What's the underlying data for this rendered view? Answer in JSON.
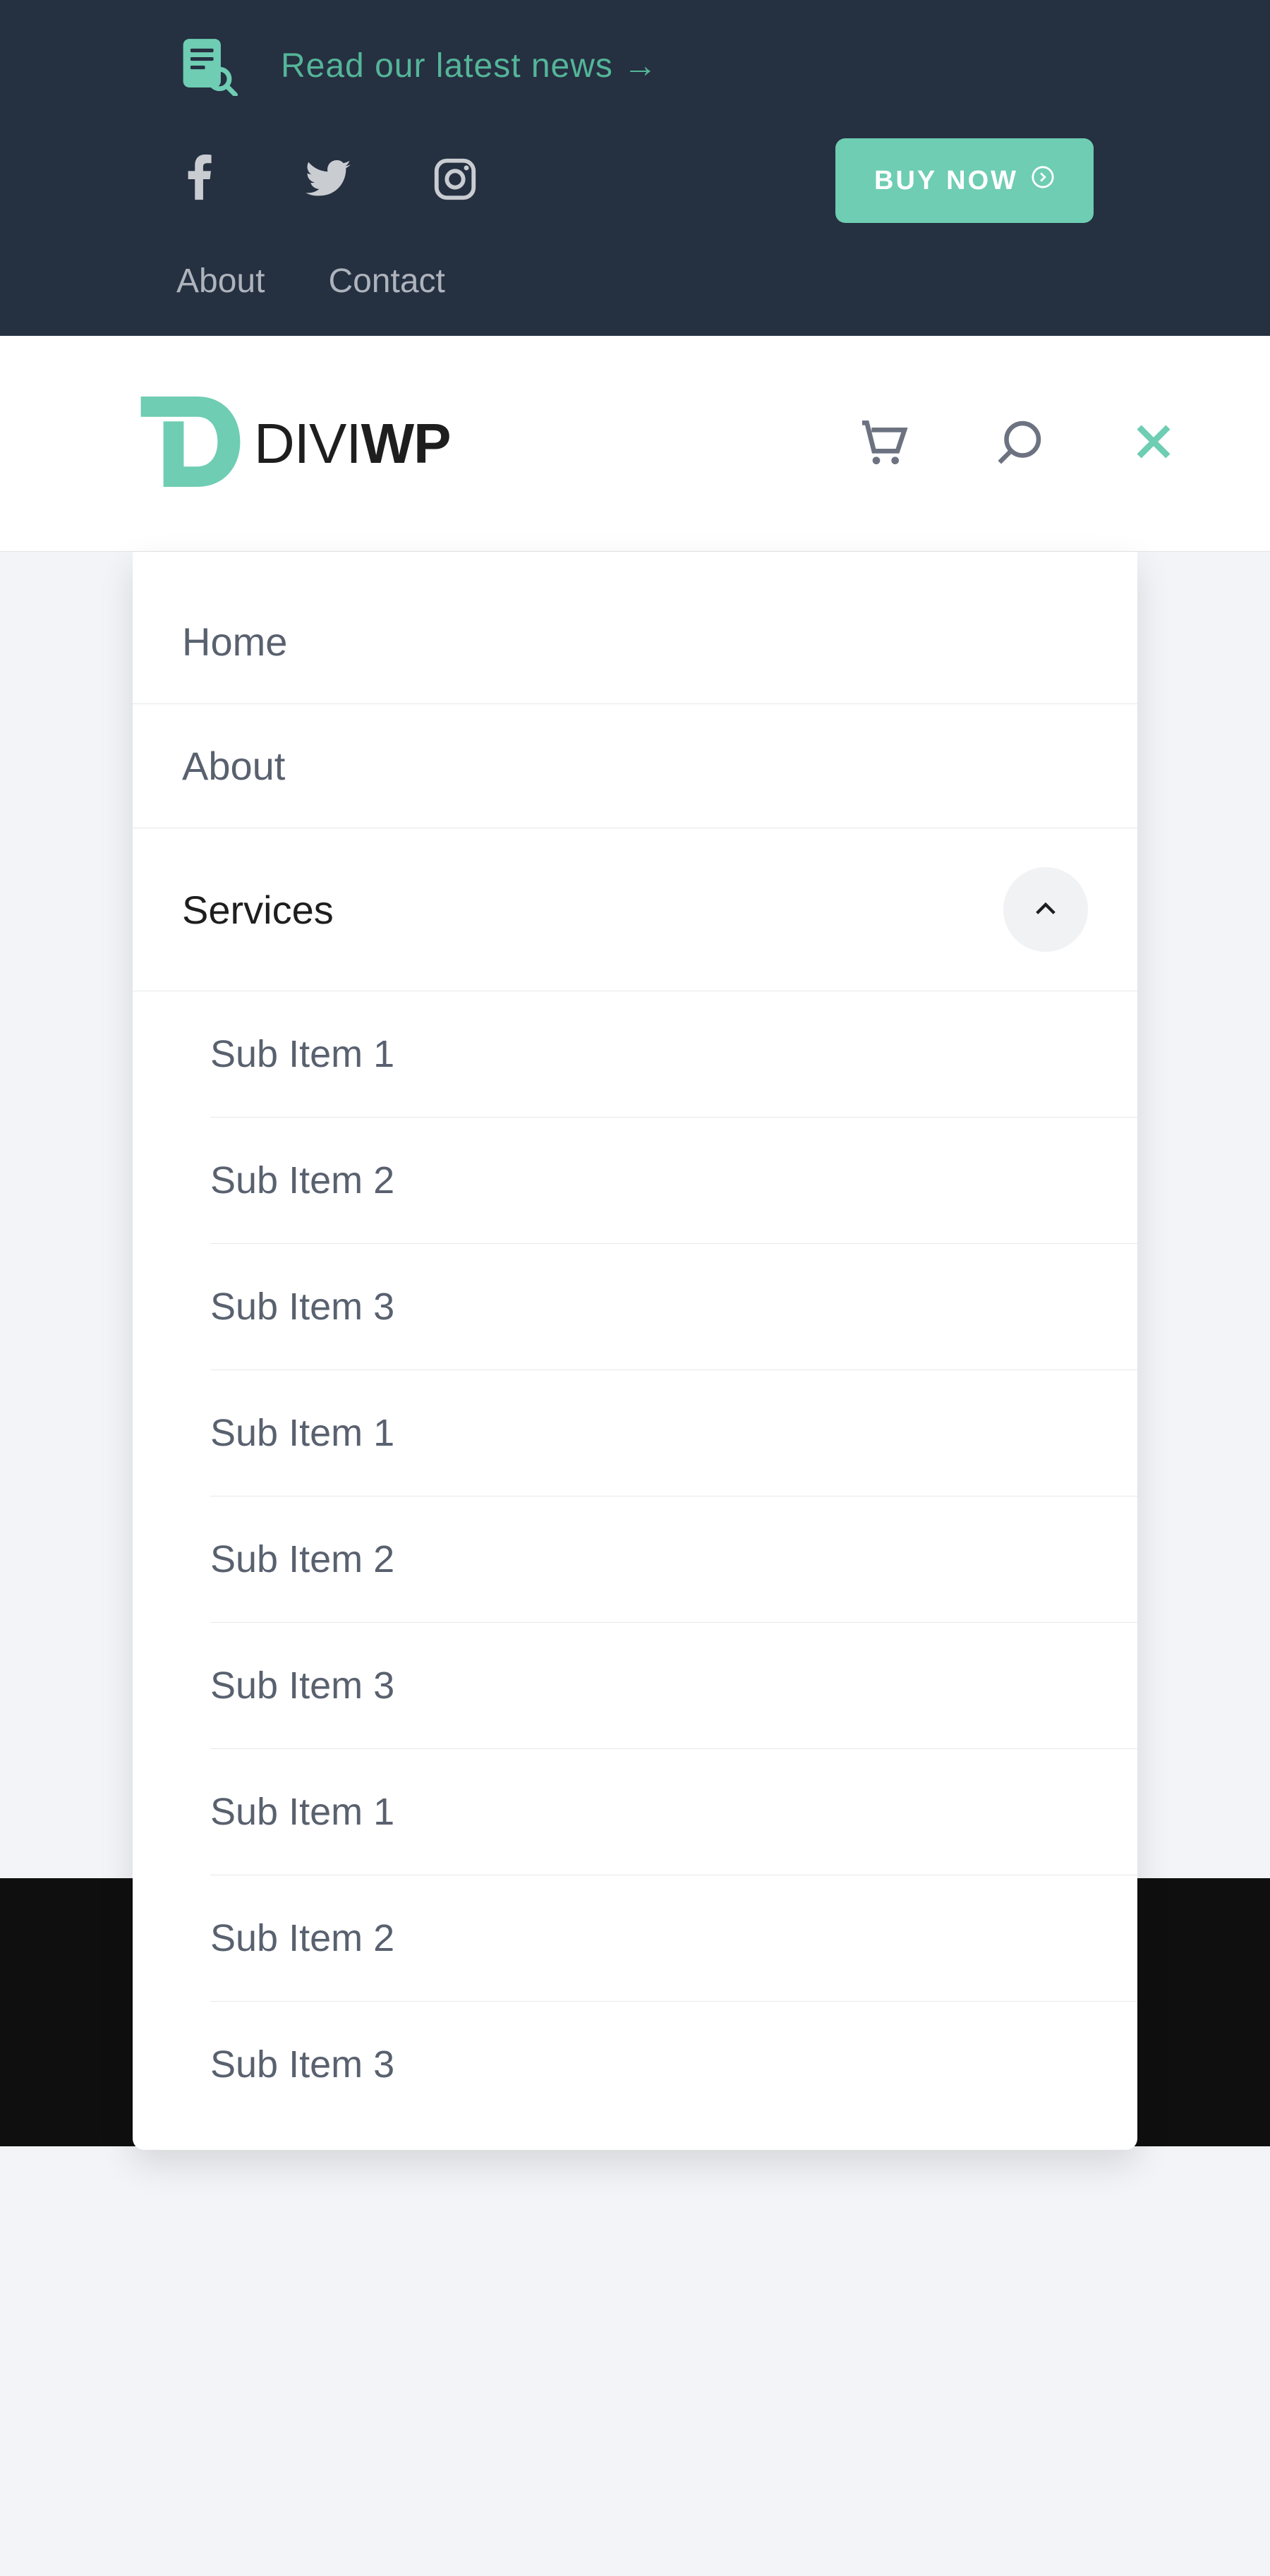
{
  "topbar": {
    "news_label": "Read our latest news →",
    "buy_label": "BUY NOW",
    "links": [
      "About",
      "Contact"
    ]
  },
  "header": {
    "logo_light": "DIVI",
    "logo_bold": "WP"
  },
  "menu": {
    "items": [
      {
        "label": "Home",
        "active": false
      },
      {
        "label": "About",
        "active": false
      },
      {
        "label": "Services",
        "active": true,
        "expanded": true
      }
    ],
    "sub_items": [
      "Sub Item 1",
      "Sub Item 2",
      "Sub Item 3",
      "Sub Item 1",
      "Sub Item 2",
      "Sub Item 3",
      "Sub Item 1",
      "Sub Item 2",
      "Sub Item 3"
    ]
  },
  "icons": {
    "news": "document-search-icon",
    "facebook": "facebook-icon",
    "twitter": "twitter-icon",
    "instagram": "instagram-icon",
    "cart": "cart-icon",
    "search": "search-icon",
    "close": "close-icon",
    "chevron": "chevron-up-icon",
    "buy_arrow": "circle-arrow-icon"
  },
  "colors": {
    "dark": "#253041",
    "teal": "#6ECDB2",
    "text_muted": "#59616F"
  }
}
